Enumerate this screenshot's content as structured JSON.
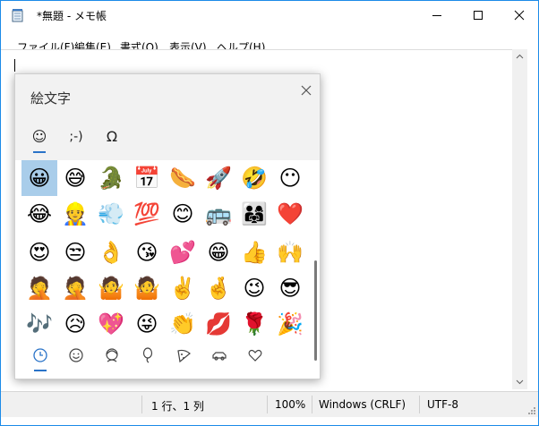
{
  "window": {
    "title": "*無題 - メモ帳"
  },
  "menu": [
    {
      "label": "ファイル(F)"
    },
    {
      "label": "編集(E)"
    },
    {
      "label": "書式(O)"
    },
    {
      "label": "表示(V)"
    },
    {
      "label": "ヘルプ(H)"
    }
  ],
  "editor": {
    "text": ""
  },
  "status": {
    "position": "1 行、1 列",
    "zoom": "100%",
    "line_ending": "Windows (CRLF)",
    "encoding": "UTF-8"
  },
  "emoji_panel": {
    "title": "絵文字",
    "category_tabs": [
      {
        "name": "emoji",
        "glyph": "☺"
      },
      {
        "name": "kaomoji",
        "glyph": ";-)"
      },
      {
        "name": "symbols",
        "glyph": "Ω"
      }
    ],
    "emoji_rows": [
      [
        "😀",
        "😅",
        "🐊",
        "📅",
        "🌭",
        "🚀",
        "🤣",
        "😶"
      ],
      [
        "😂",
        "👷",
        "💨",
        "💯",
        "😊",
        "🚌",
        "👨‍👩‍👧",
        "❤️"
      ],
      [
        "😍",
        "😒",
        "👌",
        "😘",
        "💕",
        "😁",
        "👍",
        "🙌"
      ],
      [
        "🤦",
        "🤦",
        "🤷",
        "🤷",
        "✌️",
        "🤞",
        "😉",
        "😎"
      ],
      [
        "🎶",
        "😥",
        "💖",
        "😜",
        "👏",
        "💋",
        "🌹",
        "🎉"
      ]
    ],
    "selected_emoji": "😀",
    "bottom_tabs": [
      {
        "name": "recent"
      },
      {
        "name": "smiley"
      },
      {
        "name": "people"
      },
      {
        "name": "celebration"
      },
      {
        "name": "food"
      },
      {
        "name": "travel"
      },
      {
        "name": "heart"
      }
    ]
  }
}
